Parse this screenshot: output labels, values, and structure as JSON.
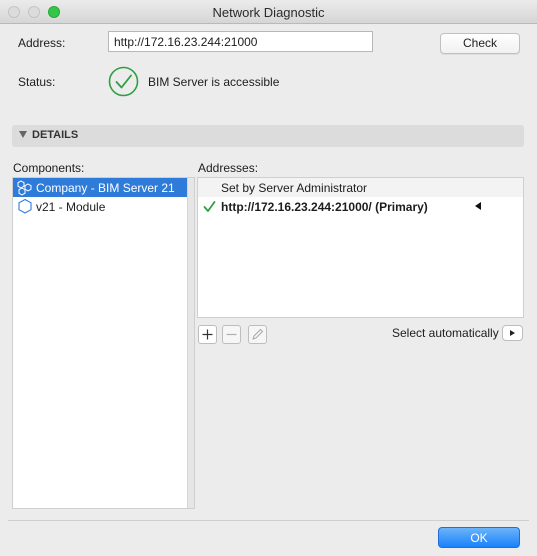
{
  "window": {
    "title": "Network Diagnostic"
  },
  "address": {
    "label": "Address:",
    "value": "http://172.16.23.244:21000",
    "check_label": "Check"
  },
  "status": {
    "label": "Status:",
    "icon": "checkmark-circle-icon",
    "text": "BIM Server is accessible",
    "icon_color": "#2ea043"
  },
  "details": {
    "label": "DETAILS"
  },
  "components": {
    "label": "Components:",
    "items": [
      {
        "label": "Company - BIM Server 21",
        "icon": "server-cluster-icon",
        "selected": true
      },
      {
        "label": "v21 - Module",
        "icon": "hexagon-module-icon",
        "selected": false
      }
    ]
  },
  "addresses": {
    "label": "Addresses:",
    "header": "Set by Server Administrator",
    "rows": [
      {
        "text": "http://172.16.23.244:21000/ (Primary)",
        "check_icon": "checkmark-icon",
        "marker_icon": "left-triangle-icon"
      }
    ]
  },
  "toolbar": {
    "add_icon": "plus-icon",
    "remove_icon": "minus-icon",
    "edit_icon": "pencil-icon"
  },
  "select_auto": {
    "label": "Select automatically",
    "icon": "chevron-right-icon"
  },
  "footer": {
    "ok_label": "OK"
  },
  "colors": {
    "accent": "#2f7bd9",
    "ok_button": "#1a82fb",
    "success": "#2ea043"
  }
}
